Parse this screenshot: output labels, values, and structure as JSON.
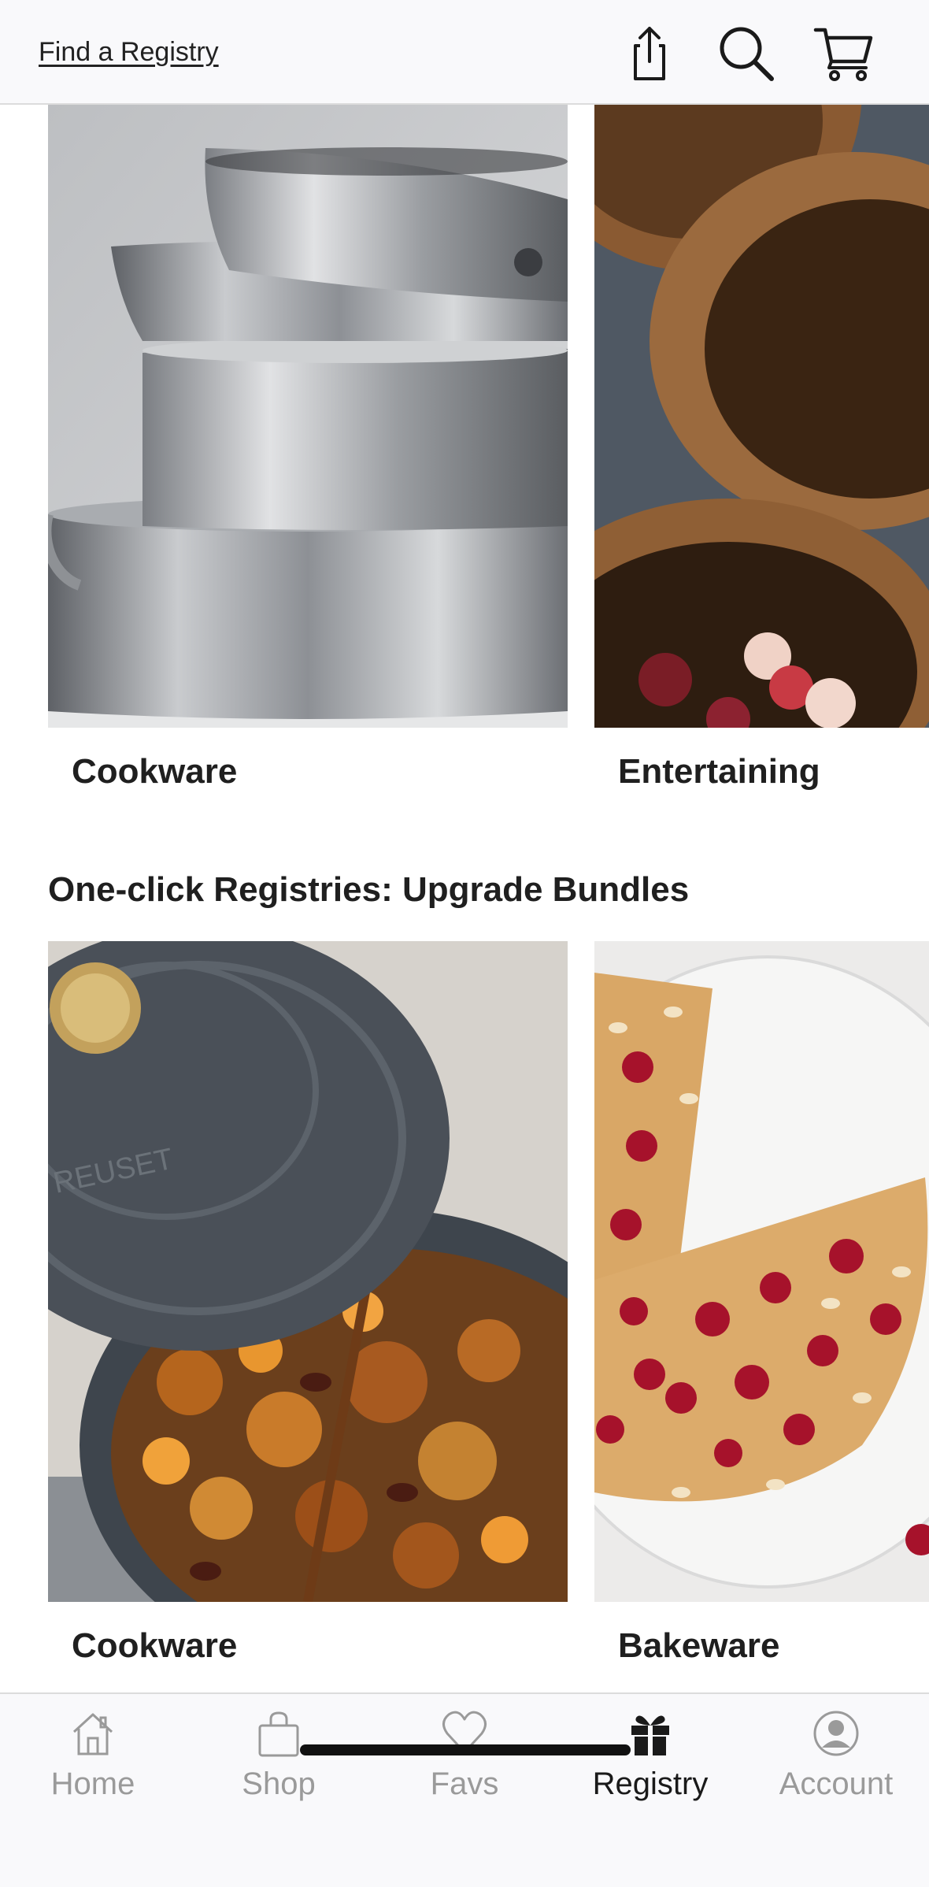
{
  "header": {
    "find_registry": "Find a Registry",
    "icons": [
      "share-icon",
      "search-icon",
      "cart-icon"
    ]
  },
  "categories_row1": [
    {
      "label": "Cookware",
      "image": "stacked-stainless-pans-image"
    },
    {
      "label": "Entertaining",
      "image": "wooden-bowls-apples-image"
    }
  ],
  "bundles": {
    "title": "One-click Registries: Upgrade Bundles",
    "items": [
      {
        "label": "Cookware",
        "image": "dutch-oven-chicken-image",
        "lid_text": "REUSET"
      },
      {
        "label": "Bakeware",
        "image": "cherry-almond-cake-image"
      }
    ]
  },
  "tabbar": {
    "items": [
      {
        "label": "Home",
        "icon": "home-icon",
        "active": false
      },
      {
        "label": "Shop",
        "icon": "shopping-bag-icon",
        "active": false
      },
      {
        "label": "Favs",
        "icon": "heart-icon",
        "active": false
      },
      {
        "label": "Registry",
        "icon": "gift-icon",
        "active": true
      },
      {
        "label": "Account",
        "icon": "account-icon",
        "active": false
      }
    ]
  },
  "colors": {
    "header_bg": "#f9f9fb",
    "text_dark": "#1a1a1a",
    "tab_inactive": "#9a9a9a"
  }
}
